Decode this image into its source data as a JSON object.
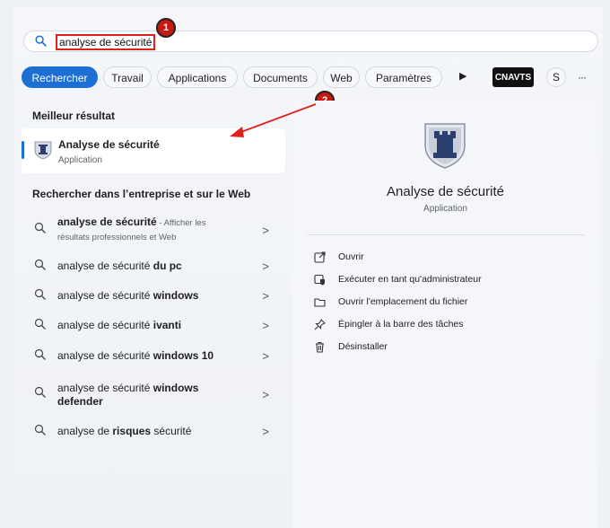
{
  "search": {
    "value": "analyse de sécurité"
  },
  "annotations": {
    "badge1": "1",
    "badge2": "2"
  },
  "tabs": {
    "rechercher": "Rechercher",
    "travail": "Travail",
    "applications": "Applications",
    "documents": "Documents",
    "web": "Web",
    "parametres": "Paramètres",
    "account": "CNAVTS",
    "avatar": "S",
    "more": "···"
  },
  "left": {
    "best_header": "Meilleur résultat",
    "best": {
      "title": "Analyse de sécurité",
      "subtitle": "Application"
    },
    "web_header": "Rechercher dans l’entreprise et sur le Web",
    "results": [
      {
        "base": "analyse de sécurité",
        "bold": "",
        "extra": " - Afficher les",
        "extra2": "résultats professionnels et Web"
      },
      {
        "base": "analyse de sécurité ",
        "bold": "du pc"
      },
      {
        "base": "analyse de sécurité ",
        "bold": "windows"
      },
      {
        "base": "analyse de sécurité ",
        "bold": "ivanti"
      },
      {
        "base": "analyse de sécurité ",
        "bold": "windows 10"
      },
      {
        "base": "analyse de sécurité ",
        "bold": "windows",
        "bold2": "defender"
      },
      {
        "base": "analyse de ",
        "bold": "risques",
        "after": " sécurité"
      }
    ],
    "chevron": ">"
  },
  "right": {
    "title": "Analyse de sécurité",
    "subtitle": "Application",
    "actions": [
      {
        "label": "Ouvrir",
        "icon": "open-icon"
      },
      {
        "label": "Exécuter en tant qu'administrateur",
        "icon": "shield-admin-icon"
      },
      {
        "label": "Ouvrir l'emplacement du fichier",
        "icon": "folder-icon"
      },
      {
        "label": "Épingler à la barre des tâches",
        "icon": "pin-icon"
      },
      {
        "label": "Désinstaller",
        "icon": "trash-icon"
      }
    ]
  },
  "colors": {
    "accent": "#1d6fd3",
    "annotation_red": "#e0201b"
  }
}
